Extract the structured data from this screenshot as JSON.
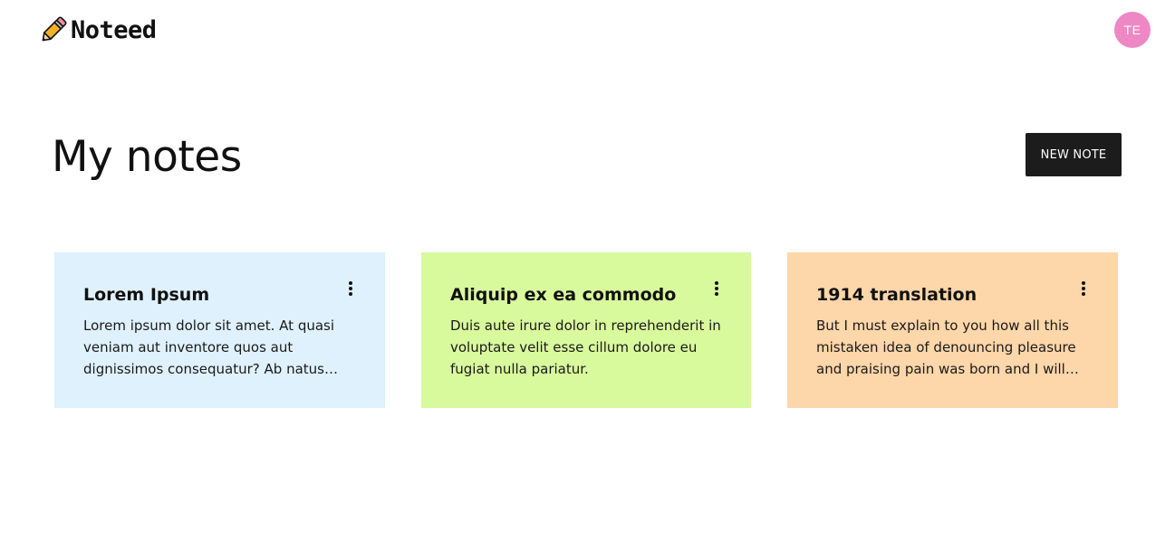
{
  "app": {
    "name": "Noteed",
    "logo_icon": "pencil-icon"
  },
  "user": {
    "initials": "TE",
    "avatar_color": "#ee88c4"
  },
  "page": {
    "title": "My notes",
    "new_note_label": "NEW NOTE"
  },
  "notes": [
    {
      "title": "Lorem Ipsum",
      "body": "Lorem ipsum dolor sit amet. At quasi veniam aut inventore quos aut dignissimos consequatur? Ab natus laborum et voluptatem quia.",
      "color": "#dff1fd",
      "menu_icon": "more-vertical-icon"
    },
    {
      "title": "Aliquip ex ea commodo",
      "body": "Duis aute irure dolor in reprehenderit in voluptate velit esse cillum dolore eu fugiat nulla pariatur.",
      "color": "#d9f99d",
      "menu_icon": "more-vertical-icon"
    },
    {
      "title": "1914 translation",
      "body": "But I must explain to you how all this mistaken idea of denouncing pleasure and praising pain was born and I will give you a complete account of the system.",
      "color": "#fdd6a9",
      "menu_icon": "more-vertical-icon"
    }
  ]
}
